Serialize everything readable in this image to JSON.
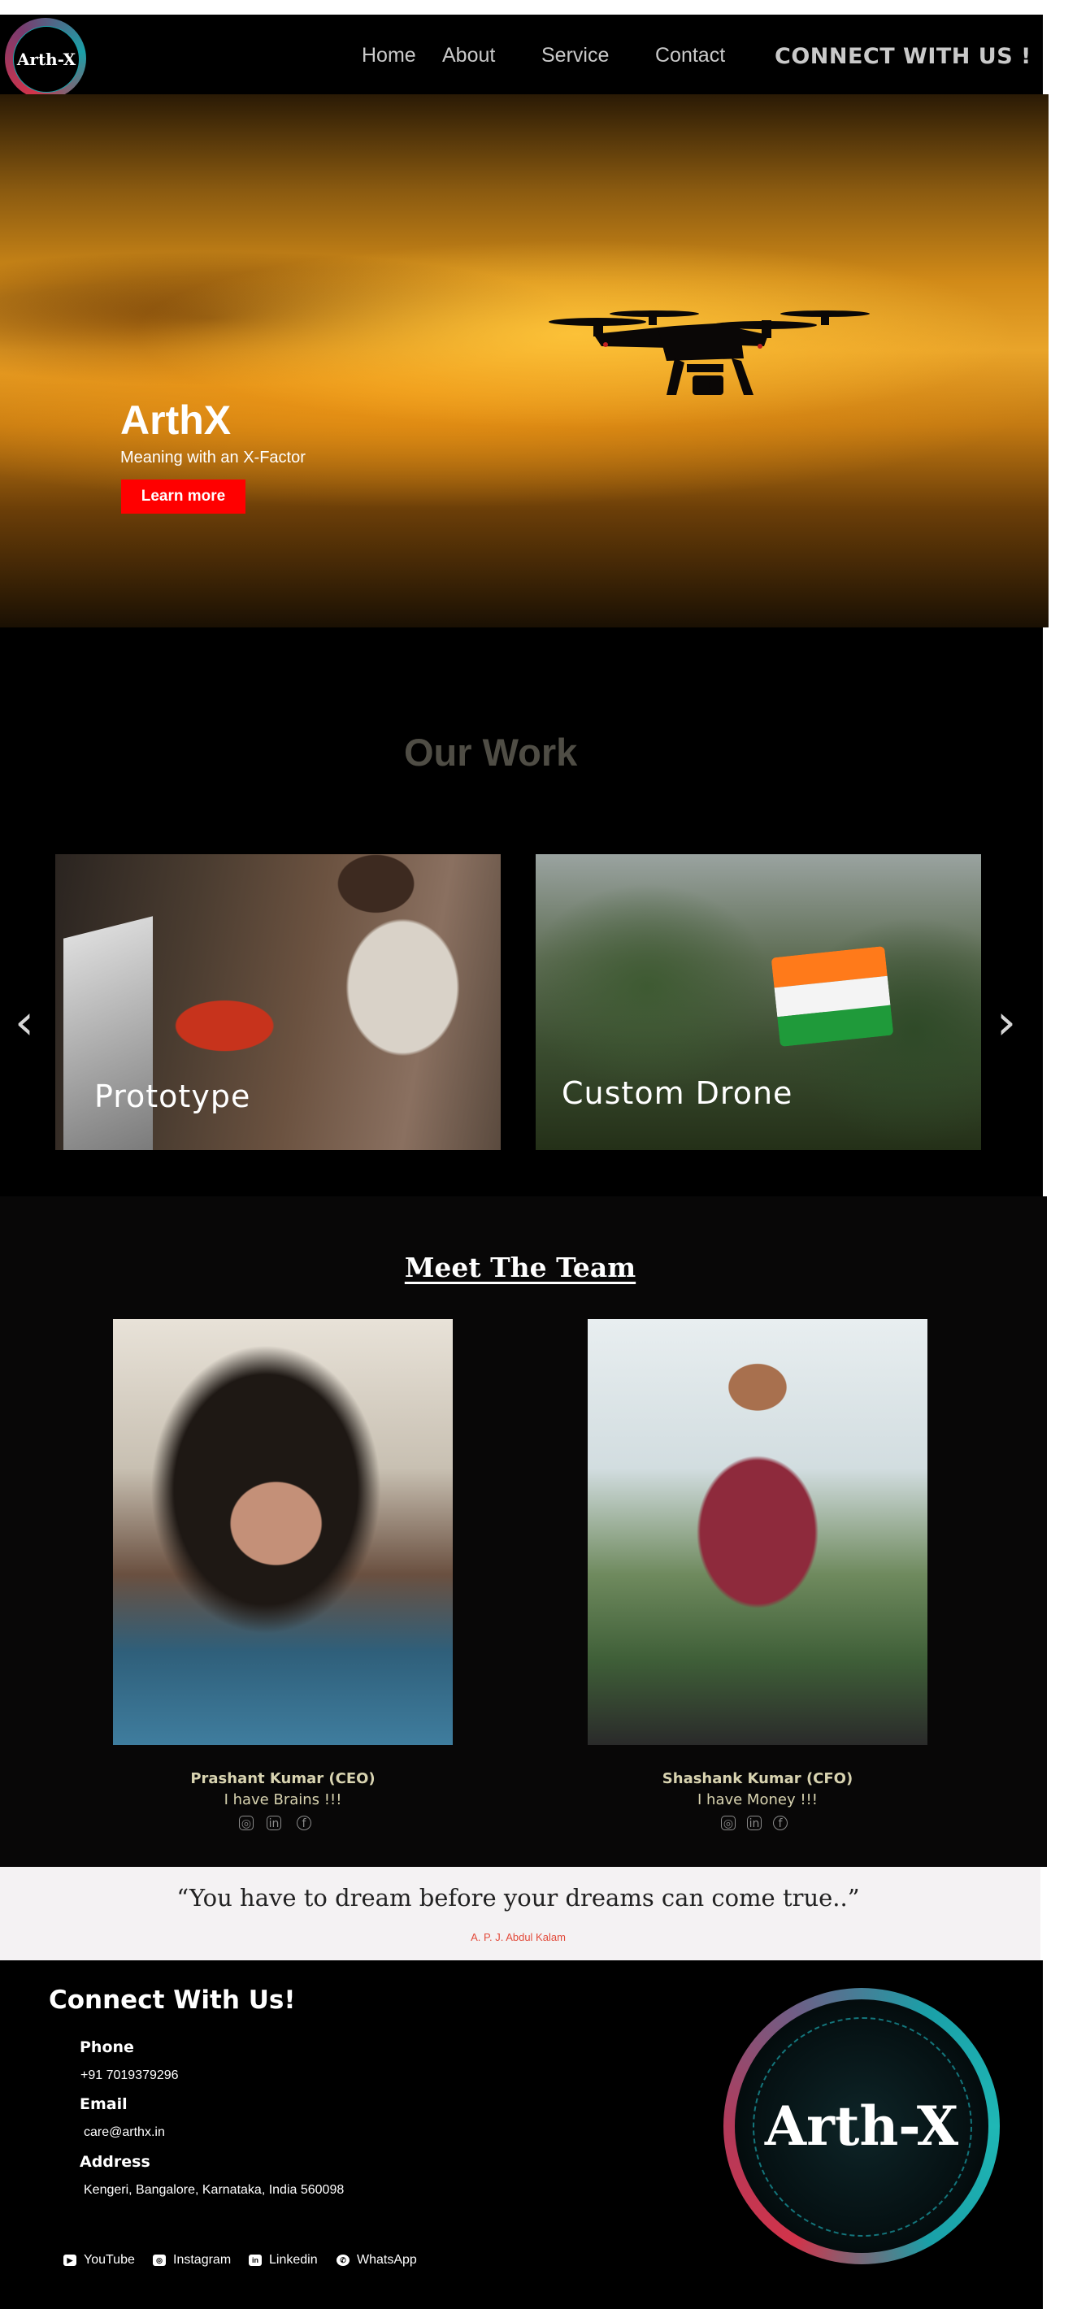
{
  "nav": {
    "logo_text": "Arth-X",
    "links": [
      "Home",
      "About",
      "Service",
      "Contact"
    ],
    "cta": "CONNECT WITH US !"
  },
  "hero": {
    "title": "ArthX",
    "subtitle": "Meaning with an X-Factor",
    "button": "Learn more"
  },
  "work": {
    "title": "Our Work",
    "cards": [
      {
        "label": "Prototype"
      },
      {
        "label": "Custom Drone"
      }
    ],
    "prev": "‹",
    "next": "›"
  },
  "team": {
    "title": "Meet The Team",
    "members": [
      {
        "name": "Prashant Kumar (CEO)",
        "quote": "I have Brains !!!",
        "socials": [
          "instagram-icon",
          "linkedin-icon",
          "facebook-icon"
        ]
      },
      {
        "name": "Shashank Kumar (CFO)",
        "quote": "I have Money !!!",
        "socials": [
          "instagram-icon",
          "linkedin-icon",
          "facebook-icon"
        ]
      }
    ]
  },
  "quote": {
    "text": "“You have to dream before your dreams can come true..”",
    "author": "A. P. J. Abdul Kalam"
  },
  "footer": {
    "title": "Connect With Us!",
    "phone_label": "Phone",
    "phone": "+91 7019379296",
    "email_label": "Email",
    "email": "care@arthx.in",
    "address_label": "Address",
    "address": "Kengeri, Bangalore, Karnataka, India 560098",
    "logo_text": "Arth-X",
    "socials": [
      {
        "label": "YouTube",
        "icon": "youtube-icon"
      },
      {
        "label": "Instagram",
        "icon": "instagram-icon"
      },
      {
        "label": "Linkedin",
        "icon": "linkedin-icon"
      },
      {
        "label": "WhatsApp",
        "icon": "whatsapp-icon"
      }
    ]
  },
  "colors": {
    "accent_red": "#ff0000",
    "team_text": "#d8d3b0",
    "quote_author": "#e24a3a"
  }
}
